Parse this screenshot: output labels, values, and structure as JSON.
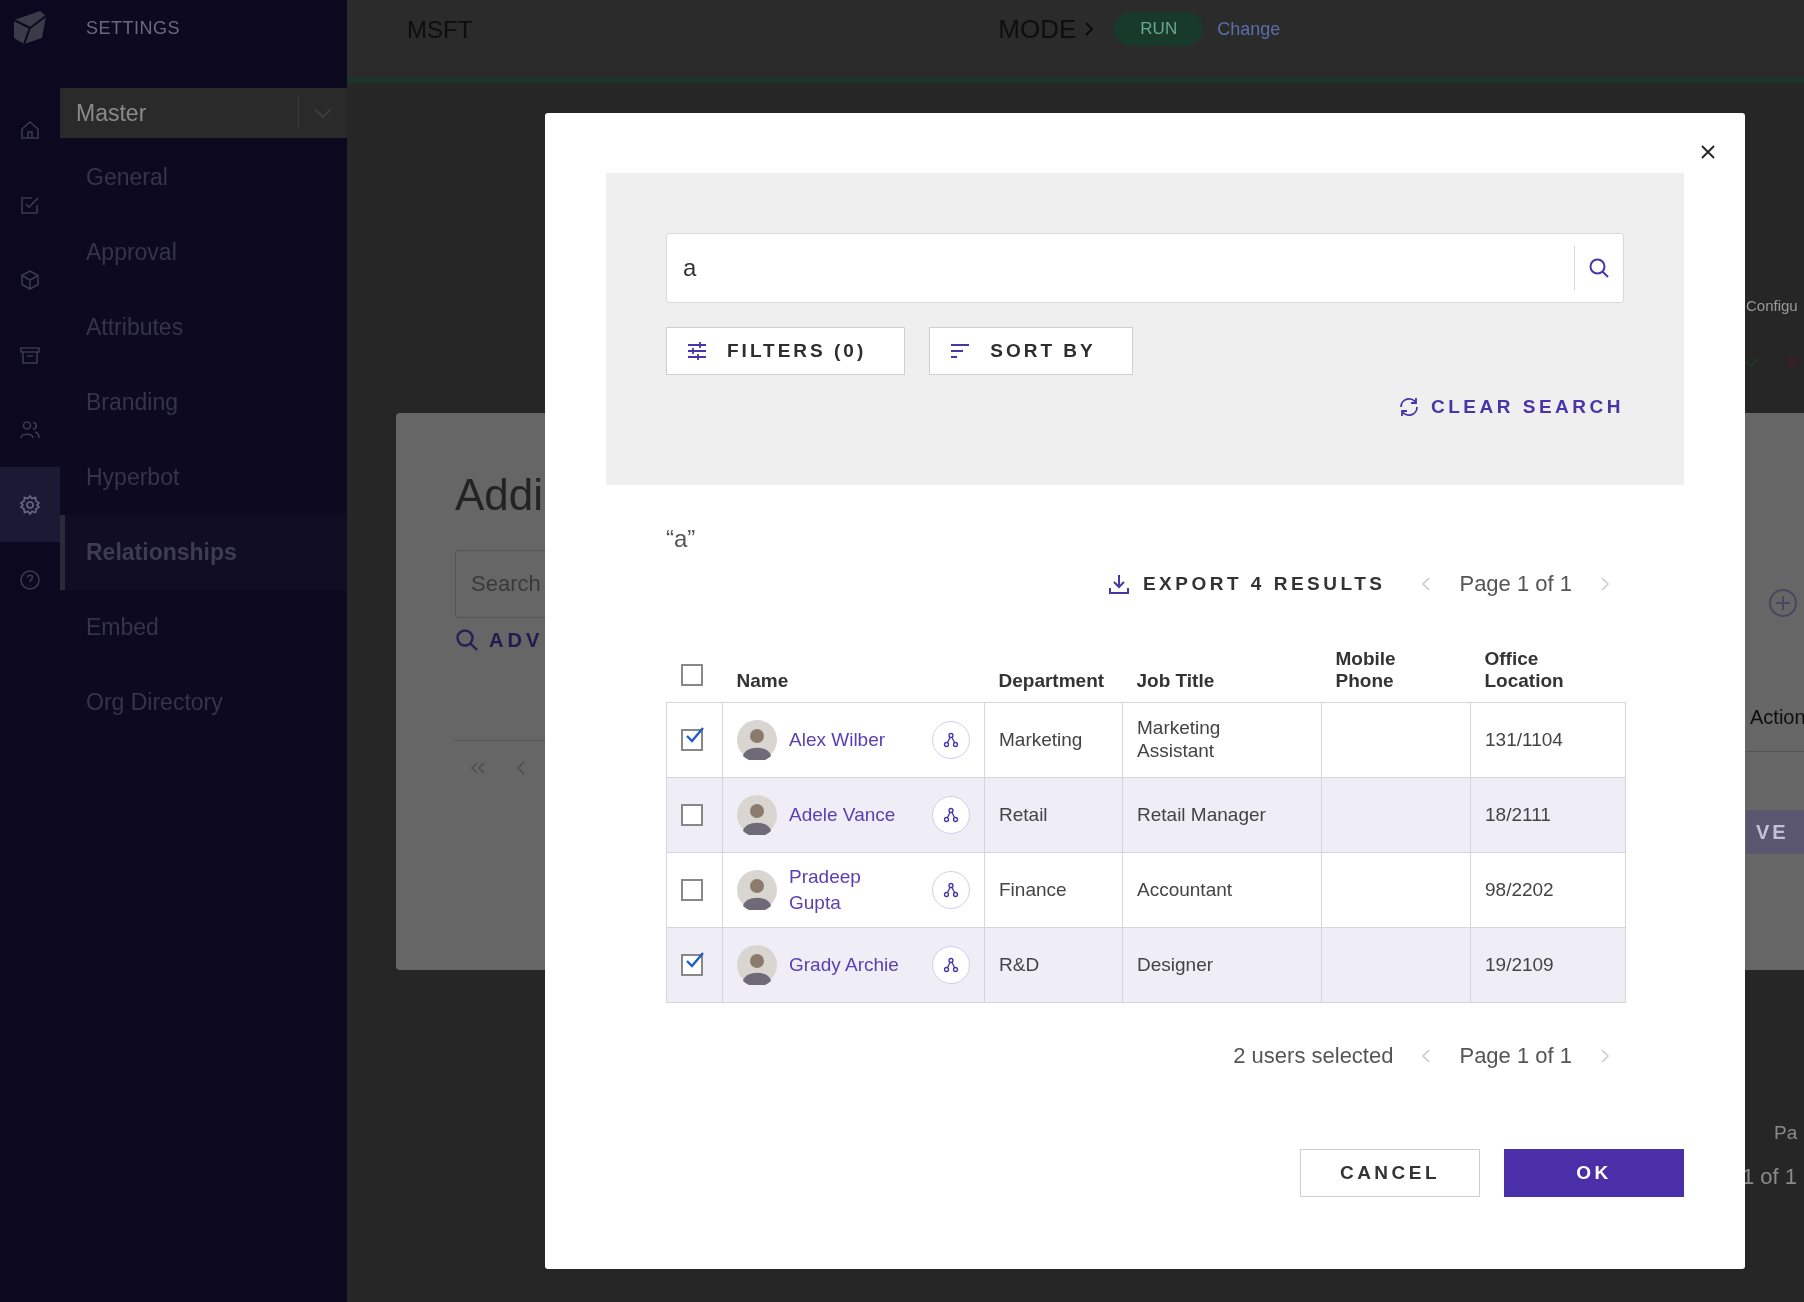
{
  "sidebar": {
    "heading": "SETTINGS",
    "dropdown": {
      "value": "Master"
    },
    "rail": [
      {
        "kind": "home",
        "selected": false
      },
      {
        "kind": "checklist",
        "selected": false
      },
      {
        "kind": "cube",
        "selected": false
      },
      {
        "kind": "archive",
        "selected": false
      },
      {
        "kind": "users",
        "selected": false
      },
      {
        "kind": "settings",
        "selected": true
      },
      {
        "kind": "help",
        "selected": false
      }
    ],
    "items": [
      {
        "label": "General",
        "selected": false
      },
      {
        "label": "Approval",
        "selected": false
      },
      {
        "label": "Attributes",
        "selected": false
      },
      {
        "label": "Branding",
        "selected": false
      },
      {
        "label": "Hyperbot",
        "selected": false
      },
      {
        "label": "Relationships",
        "selected": true
      },
      {
        "label": "Embed",
        "selected": false
      },
      {
        "label": "Org Directory",
        "selected": false
      }
    ]
  },
  "topbar": {
    "org": "MSFT",
    "mode_label": "MODE",
    "mode_value": "RUN",
    "change_link": "Change"
  },
  "background": {
    "title": "Addi",
    "search_placeholder": "Search",
    "advanced_link": "ADV",
    "column_heading": "Configu",
    "actions_heading": "Action",
    "button": "VE",
    "page_label": "Pa",
    "page_count": "1 of 1"
  },
  "dialog": {
    "search": {
      "value": "a"
    },
    "filters_button": "FILTERS (0)",
    "sort_button": "SORT BY",
    "clear_search": "CLEAR SEARCH",
    "query": "“a”",
    "export_button": "EXPORT 4 RESULTS",
    "pager_top": "Page 1 of 1",
    "table": {
      "all_checked": false,
      "columns": [
        "Name",
        "Department",
        "Job Title",
        "Mobile Phone",
        "Office Location"
      ],
      "rows": [
        {
          "checked": true,
          "name": "Alex Wilber",
          "department": "Marketing",
          "job_title": "Marketing Assistant",
          "office_location": "131/1104"
        },
        {
          "checked": false,
          "name": "Adele Vance",
          "department": "Retail",
          "job_title": "Retail Manager",
          "office_location": "18/2111"
        },
        {
          "checked": false,
          "name": "Pradeep Gupta",
          "department": "Finance",
          "job_title": "Accountant",
          "office_location": "98/2202"
        },
        {
          "checked": true,
          "name": "Grady Archie",
          "department": "R&D",
          "job_title": "Designer",
          "office_location": "19/2109"
        }
      ]
    },
    "selection_count": "2 users selected",
    "pager_bottom": "Page 1 of 1",
    "cancel_button": "CANCEL",
    "ok_button": "OK"
  }
}
